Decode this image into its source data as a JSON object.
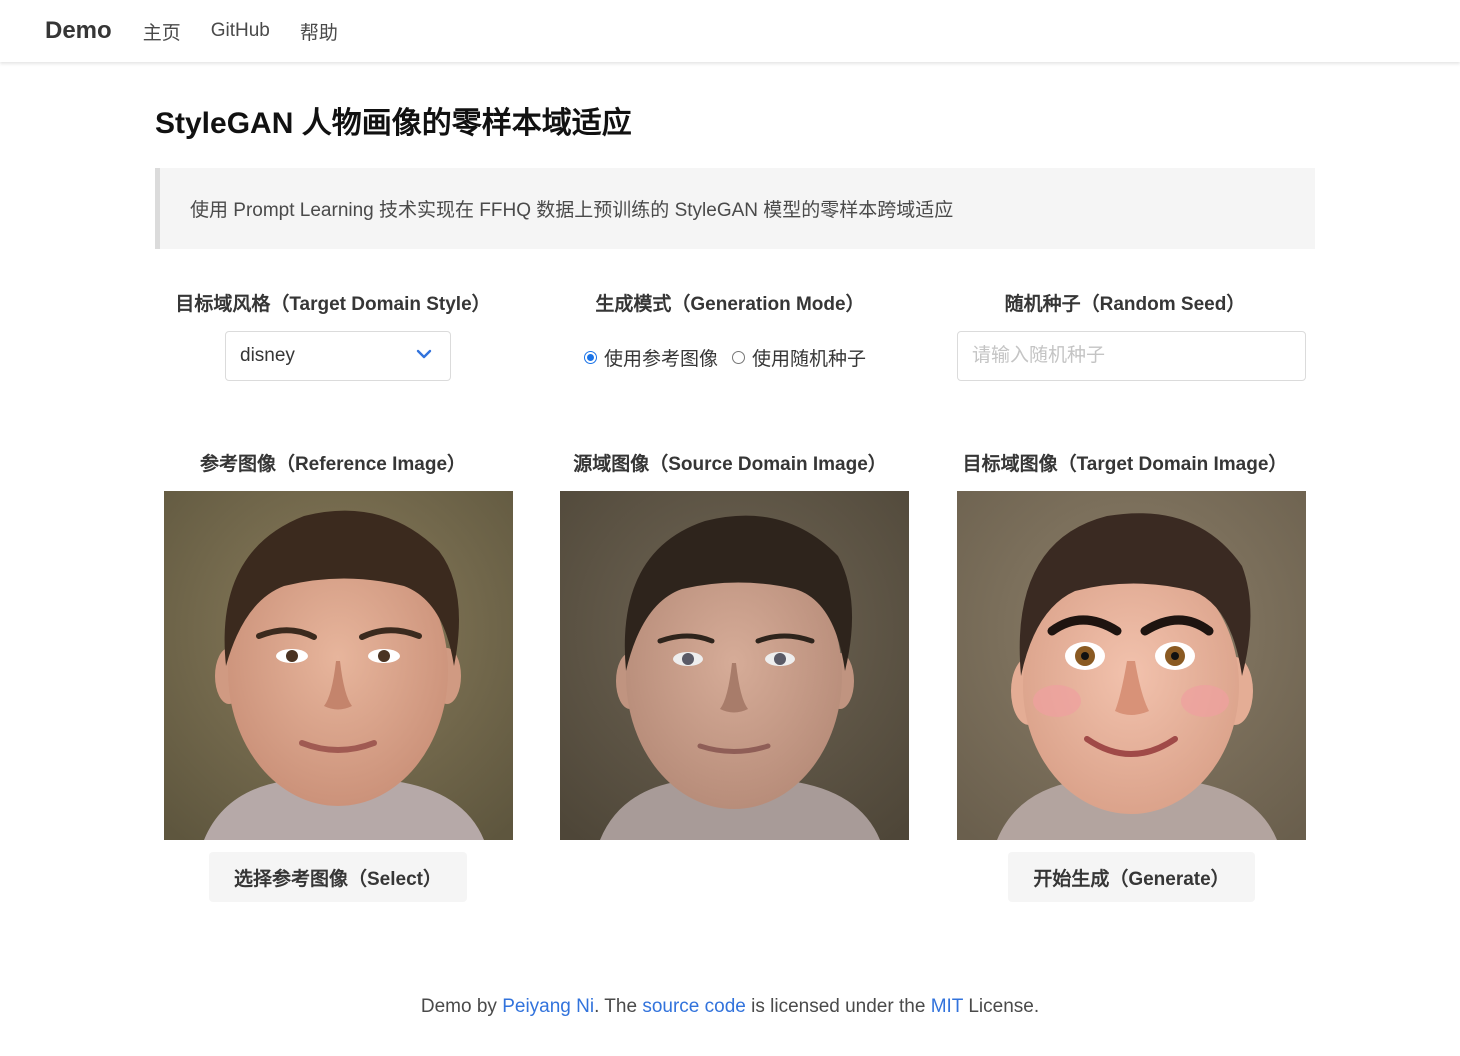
{
  "navbar": {
    "brand": "Demo",
    "links": [
      "主页",
      "GitHub",
      "帮助"
    ]
  },
  "page": {
    "title": "StyleGAN 人物画像的零样本域适应",
    "notice": "使用 Prompt Learning 技术实现在 FFHQ 数据上预训练的 StyleGAN 模型的零样本跨域适应"
  },
  "controls": {
    "style_label": "目标域风格（Target Domain Style）",
    "style_selected": "disney",
    "mode_label": "生成模式（Generation Mode）",
    "mode_options": [
      "使用参考图像",
      "使用随机种子"
    ],
    "mode_selected_index": 0,
    "seed_label": "随机种子（Random Seed）",
    "seed_placeholder": "请输入随机种子",
    "seed_value": ""
  },
  "images": {
    "reference_label": "参考图像（Reference Image）",
    "source_label": "源域图像（Source Domain Image）",
    "target_label": "目标域图像（Target Domain Image）",
    "select_button": "选择参考图像（Select）",
    "generate_button": "开始生成（Generate）"
  },
  "footer": {
    "prefix": "Demo by ",
    "author": "Peiyang Ni",
    "middle1": ". The ",
    "source_link": "source code",
    "middle2": " is licensed under the ",
    "license_link": "MIT",
    "suffix": " License."
  },
  "colors": {
    "link": "#3273dc",
    "radio_accent": "#1a73e8",
    "notice_bg": "#f5f5f5",
    "button_bg": "#f5f5f5"
  },
  "icons": {
    "select_arrow": "chevron-down-icon"
  }
}
